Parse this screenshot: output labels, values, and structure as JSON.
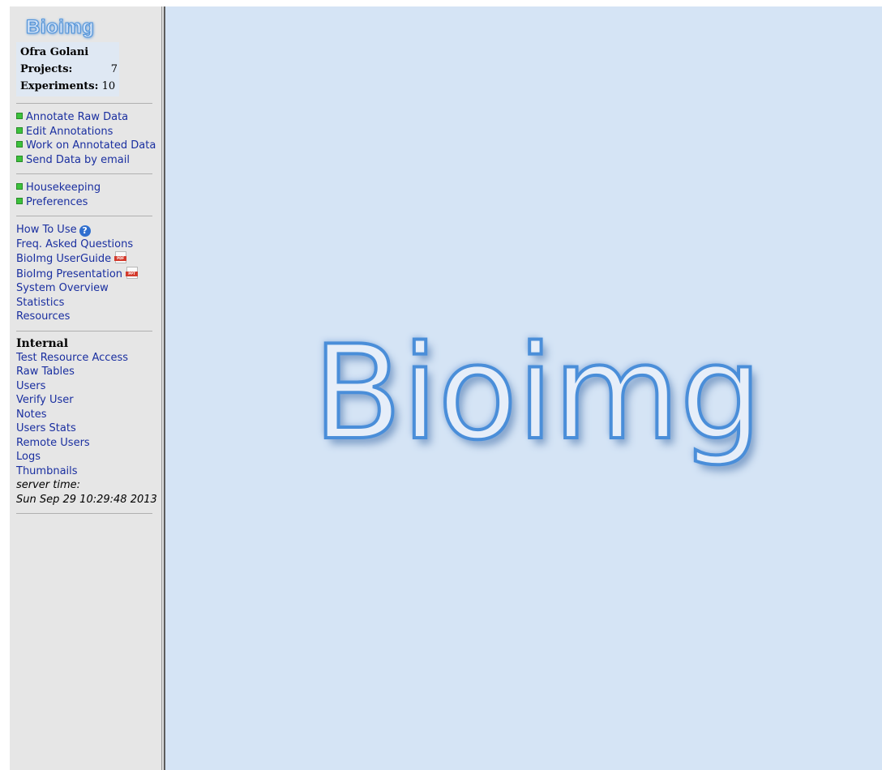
{
  "app": {
    "logo_small": "Bioimg",
    "logo_large": "Bioimg"
  },
  "user": {
    "name": "Ofra Golani",
    "projects_label": "Projects:",
    "projects_count": "7",
    "experiments_label": "Experiments:",
    "experiments_count": "10"
  },
  "nav": {
    "actions": [
      {
        "label": "Annotate Raw Data"
      },
      {
        "label": "Edit Annotations"
      },
      {
        "label": "Work on Annotated Data"
      },
      {
        "label": "Send Data by email"
      }
    ],
    "settings": [
      {
        "label": "Housekeeping"
      },
      {
        "label": "Preferences"
      }
    ],
    "help": {
      "how_to_use": "How To Use",
      "faq": "Freq. Asked Questions",
      "userguide": "BioImg UserGuide",
      "presentation": "BioImg Presentation",
      "system_overview": "System Overview",
      "statistics": "Statistics",
      "resources": "Resources"
    },
    "internal": {
      "title": "Internal",
      "items": [
        {
          "label": "Test Resource Access"
        },
        {
          "label": "Raw Tables"
        },
        {
          "label": "Users"
        },
        {
          "label": "Verify User"
        },
        {
          "label": "Notes"
        },
        {
          "label": "Users Stats"
        },
        {
          "label": "Remote Users"
        },
        {
          "label": "Logs"
        },
        {
          "label": "Thumbnails"
        }
      ]
    },
    "server_time_label": "server time:",
    "server_time_value": "Sun Sep 29 10:29:48 2013"
  },
  "icons": {
    "bullet": "green-square-bullet-icon",
    "help": "help-question-icon",
    "pdf": "pdf-file-icon",
    "ppt": "ppt-file-icon",
    "pdf_tag": "PDF",
    "ppt_tag": "PPT"
  },
  "colors": {
    "link": "#1a2fa0",
    "sidebar_bg": "#e6e6e6",
    "main_bg": "#d5e4f5",
    "bullet": "#3cc23c",
    "logo_stroke": "#4a8ed9"
  }
}
